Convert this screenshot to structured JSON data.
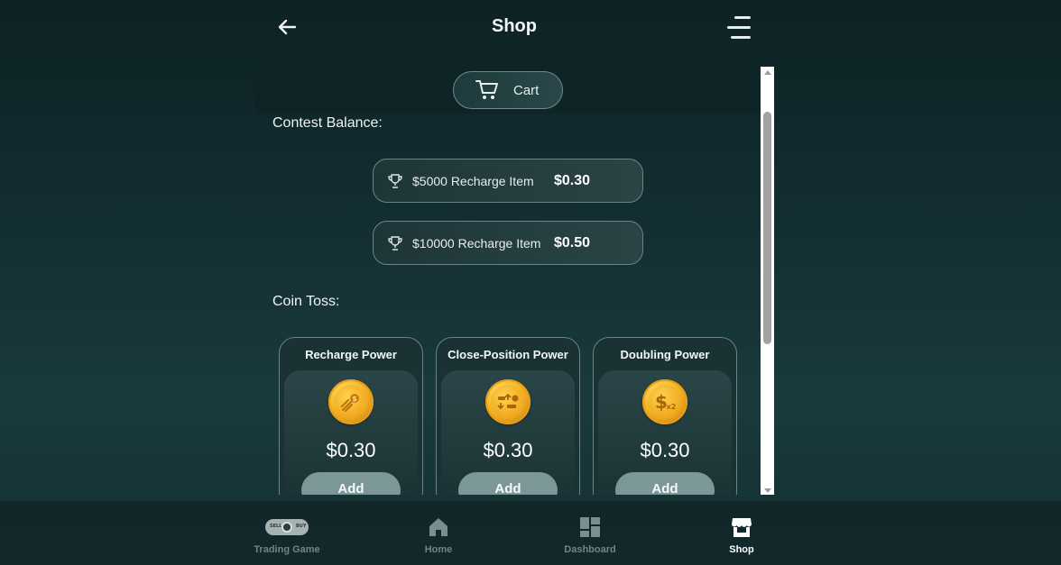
{
  "header": {
    "title": "Shop",
    "back_icon": "arrow-left-icon",
    "menu_icon": "hamburger-menu-icon"
  },
  "cart": {
    "label": "Cart",
    "icon": "shopping-cart-icon"
  },
  "contest_balance": {
    "label": "Contest Balance:",
    "items": [
      {
        "name": "$5000 Recharge Item",
        "price": "$0.30",
        "icon": "trophy-icon"
      },
      {
        "name": "$10000 Recharge Item",
        "price": "$0.50",
        "icon": "trophy-icon"
      }
    ]
  },
  "coin_toss": {
    "label": "Coin Toss:",
    "powers": [
      {
        "title": "Recharge Power",
        "price": "$0.30",
        "button": "Add",
        "icon": "recharge-coin-icon"
      },
      {
        "title": "Close-Position Power",
        "price": "$0.30",
        "button": "Add",
        "icon": "close-position-coin-icon"
      },
      {
        "title": "Doubling Power",
        "price": "$0.30",
        "button": "Add",
        "icon": "doubling-coin-icon"
      }
    ]
  },
  "bottom_nav": {
    "items": [
      {
        "label": "Trading Game",
        "icon": "sell-buy-toggle-icon",
        "active": false,
        "toggle_left": "SELL",
        "toggle_right": "BUY"
      },
      {
        "label": "Home",
        "icon": "home-icon",
        "active": false
      },
      {
        "label": "Dashboard",
        "icon": "dashboard-icon",
        "active": false
      },
      {
        "label": "Shop",
        "icon": "shop-icon",
        "active": true
      }
    ]
  },
  "colors": {
    "background": "#143034",
    "button_fill": "#7b9798",
    "coin_gold": "#f5b623",
    "inactive_nav": "#6f8686"
  }
}
